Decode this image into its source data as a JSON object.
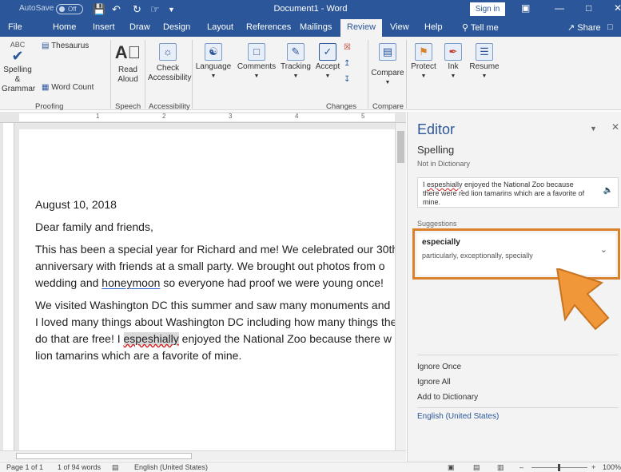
{
  "titlebar": {
    "autosave": "AutoSave",
    "autosave_state": "Off",
    "document": "Document1 - Word",
    "sign_in": "Sign in",
    "save_icon": "save-icon",
    "undo_icon": "undo-icon",
    "redo_icon": "redo-icon"
  },
  "tabs": [
    "File",
    "Home",
    "Insert",
    "Draw",
    "Design",
    "Layout",
    "References",
    "Mailings",
    "Review",
    "View",
    "Help"
  ],
  "tell_me": "Tell me",
  "share": "Share",
  "ribbon": {
    "spelling": "Spelling & Grammar",
    "thesaurus": "Thesaurus",
    "word_count": "Word Count",
    "read_aloud": "Read Aloud",
    "check_accessibility": "Check Accessibility",
    "language": "Language",
    "comments": "Comments",
    "tracking": "Tracking",
    "accept": "Accept",
    "compare": "Compare",
    "protect": "Protect",
    "ink": "Ink",
    "resume": "Resume",
    "groups": {
      "proofing": "Proofing",
      "speech": "Speech",
      "accessibility": "Accessibility",
      "changes": "Changes",
      "compare": "Compare"
    }
  },
  "ruler_numbers": [
    "1",
    "2",
    "3",
    "4",
    "5"
  ],
  "document": {
    "date": "August 10, 2018",
    "greeting": "Dear family and friends,",
    "p1_line1": "This has been a special year for Richard and me! We celebrated our 30th",
    "p1_line2": "anniversary with friends at a small party. We brought out photos from o",
    "p1_line3a": "wedding and ",
    "p1_line3b": "honeymoon",
    "p1_line3c": " so everyone had proof we were young once!",
    "p2_line1": "We visited Washington DC this summer and saw many monuments and",
    "p2_line2": "I loved many things about Washington DC including how many things the",
    "p2_line3a": "do that are free! I ",
    "p2_line3b": "espeshially",
    "p2_line3c": " enjoyed the National Zoo because there w",
    "p2_line4": "lion tamarins which are a favorite of mine."
  },
  "editor": {
    "title": "Editor",
    "section": "Spelling",
    "not_in_dictionary": "Not in Dictionary",
    "context_misspelled": "espeshially",
    "context_rest": " enjoyed the National Zoo because there were red lion tamarins which are a favorite of mine.",
    "context_lead": "I ",
    "suggestions_label": "Suggestions",
    "suggestion_word": "especially",
    "suggestion_synonyms": "particularly, exceptionally, specially",
    "ignore_once": "Ignore Once",
    "ignore_all": "Ignore All",
    "add_to_dictionary": "Add to Dictionary",
    "language": "English (United States)",
    "accent_color": "#d9822b"
  },
  "status": {
    "page": "Page 1 of 1",
    "words": "1 of 94 words",
    "language": "English (United States)",
    "zoom": "100%"
  },
  "colors": {
    "brand": "#2b579a",
    "highlight": "#d9822b"
  }
}
